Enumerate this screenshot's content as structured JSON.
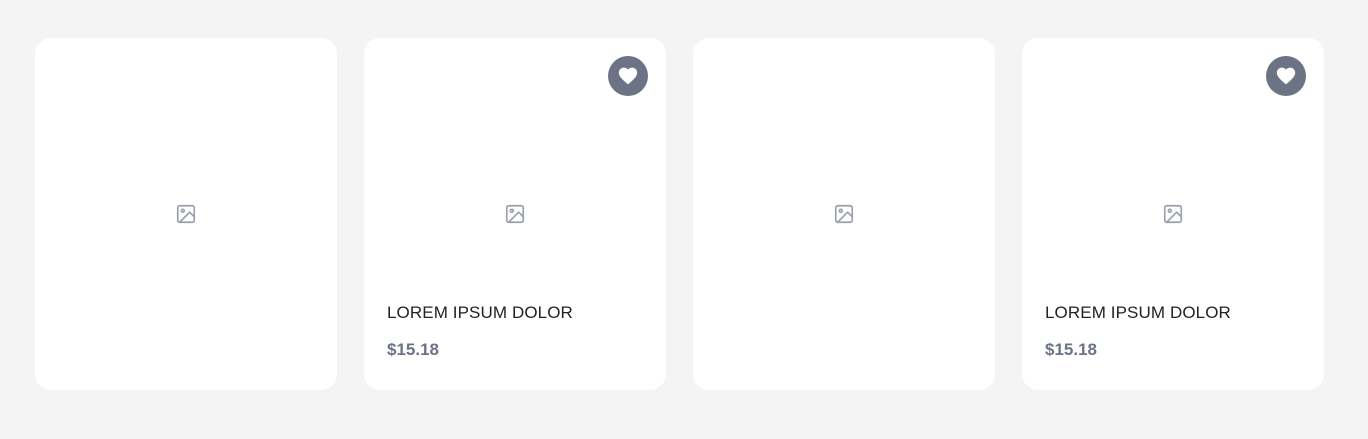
{
  "products": [
    {
      "has_info": false
    },
    {
      "has_info": true,
      "name": "LOREM IPSUM DOLOR",
      "price": "$15.18",
      "favorite_icon": "heart-icon"
    },
    {
      "has_info": false
    },
    {
      "has_info": true,
      "name": "LOREM IPSUM DOLOR",
      "price": "$15.18",
      "favorite_icon": "heart-icon"
    }
  ],
  "colors": {
    "background": "#f4f4f4",
    "card": "#ffffff",
    "accent": "#6b7385",
    "placeholder_icon": "#9aa0ab",
    "title_text": "#222222"
  },
  "icons": {
    "image_placeholder": "image-placeholder-icon",
    "favorite": "heart-icon"
  }
}
